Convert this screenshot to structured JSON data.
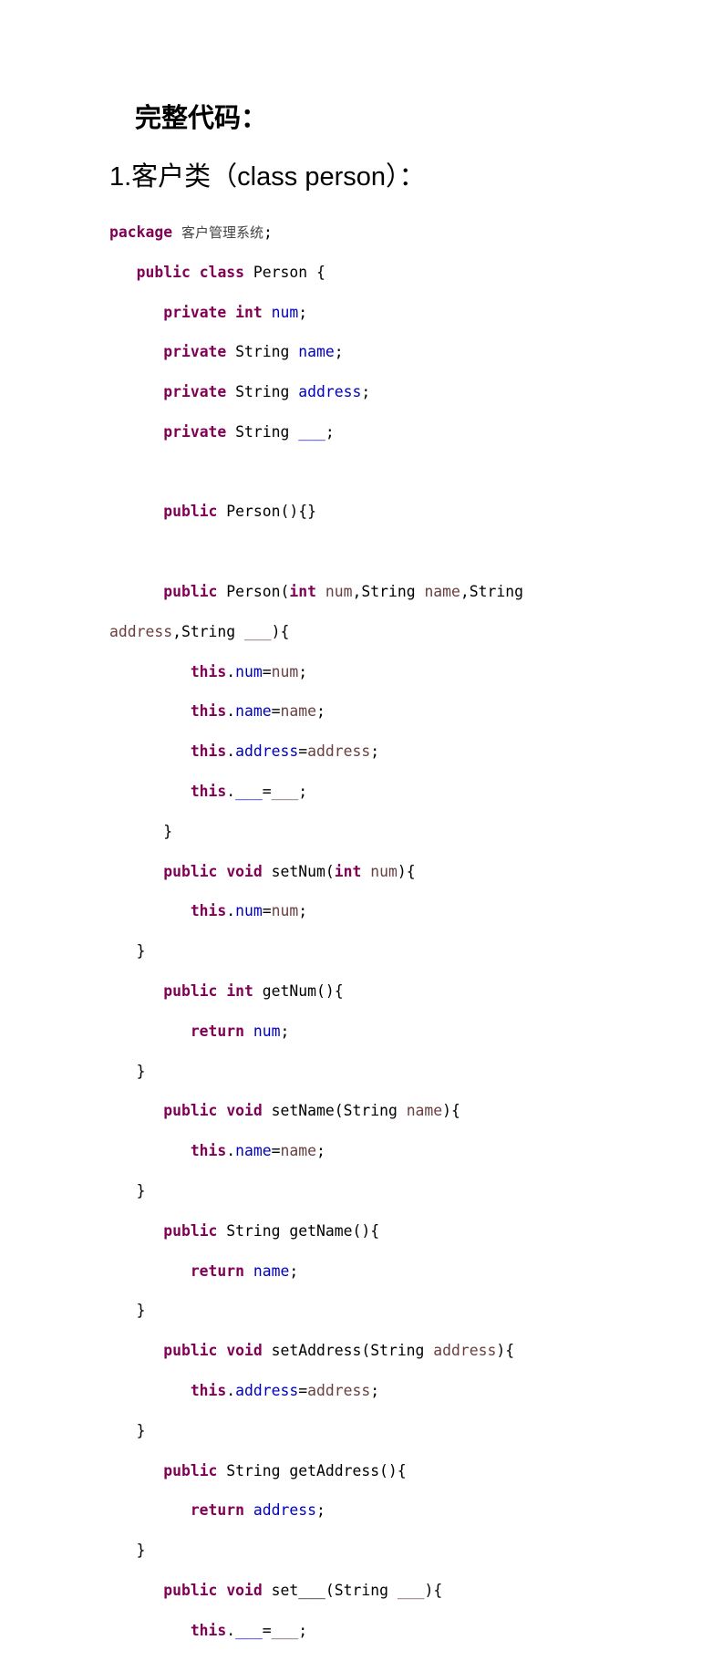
{
  "heading": "完整代码：",
  "section_title": "1.客户类（class person）：",
  "code": {
    "package_kw": "package",
    "package_name": "客户管理系统",
    "class_decl_name": "Person",
    "fields": [
      "num",
      "name",
      "address",
      "___"
    ],
    "blank": "___"
  }
}
